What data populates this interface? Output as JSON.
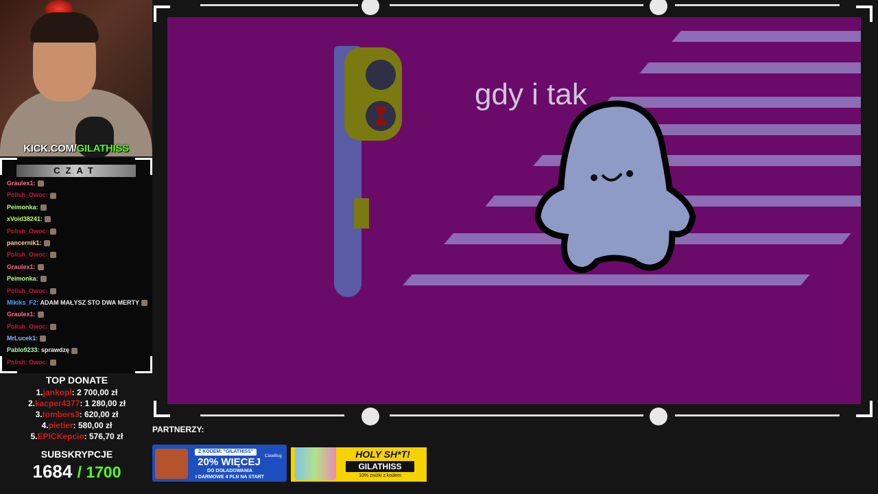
{
  "webcam": {
    "url_prefix": "KICK.COM/",
    "url_channel": "GILATHISS"
  },
  "chat": {
    "title": "CZAT",
    "messages": [
      {
        "user": "Graulex1:",
        "color": "#ff6b8a",
        "text": ""
      },
      {
        "user": "Polish_Owoc:",
        "color": "#c4163a",
        "text": ""
      },
      {
        "user": "Peimonka:",
        "color": "#b6ff8a",
        "text": ""
      },
      {
        "user": "xVoid38241:",
        "color": "#c4ff6a",
        "text": ""
      },
      {
        "user": "Polish_Owoc:",
        "color": "#c4163a",
        "text": ""
      },
      {
        "user": "pancernik1:",
        "color": "#ffd08a",
        "text": ""
      },
      {
        "user": "Polish_Owoc:",
        "color": "#c4163a",
        "text": ""
      },
      {
        "user": "Graulex1:",
        "color": "#ff6b8a",
        "text": ""
      },
      {
        "user": "Peimonka:",
        "color": "#b6ff8a",
        "text": ""
      },
      {
        "user": "Polish_Owoc:",
        "color": "#c4163a",
        "text": ""
      },
      {
        "user": "Mikiks_F2:",
        "color": "#4aa3ff",
        "text": "ADAM MAŁYSZ STO DWA MERTY"
      },
      {
        "user": "Graulex1:",
        "color": "#ff6b8a",
        "text": ""
      },
      {
        "user": "Polish_Owoc:",
        "color": "#c4163a",
        "text": ""
      },
      {
        "user": "MrLucek1:",
        "color": "#8ab8ff",
        "text": ""
      },
      {
        "user": "Pablo9233:",
        "color": "#a8ffb0",
        "text": "sprawdzę"
      },
      {
        "user": "Polish_Owoc:",
        "color": "#c4163a",
        "text": ""
      }
    ]
  },
  "top_donate": {
    "title": "TOP DONATE",
    "entries": [
      {
        "rank": "1.",
        "name": "jankopl",
        "amount": ": 2 700,00 zł"
      },
      {
        "rank": "2.",
        "name": "kacper4377",
        "amount": ": 1 280,00 zł"
      },
      {
        "rank": "3.",
        "name": "tombers3",
        "amount": ": 620,00 zł"
      },
      {
        "rank": "4.",
        "name": "pietier",
        "amount": ": 580,00 zł"
      },
      {
        "rank": "5.",
        "name": "EPICKepcio",
        "amount": ": 576,70 zł"
      }
    ]
  },
  "subs": {
    "title": "SUBSKRYPCJE",
    "current": "1684",
    "goal": "/ 1700"
  },
  "stream": {
    "caption": "gdy i tak"
  },
  "partners": {
    "label": "PARTNERZY:",
    "banner1": {
      "code": "Z KODEM: \"GILATHISS\"",
      "headline": "20% WIĘCEJ",
      "line2": "DO DOŁADOWANIA",
      "line3": "I DARMOWE 4 PLN NA START",
      "brand": "CaseBug"
    },
    "banner2": {
      "headline": "HOLY SH*T!",
      "code": "GILATHISS",
      "discount": "10% zniżki z kodem"
    }
  },
  "colors": {
    "canvas": "#6a0b6a",
    "kick_green": "#53fc18",
    "donor_red": "#d21b1b"
  }
}
